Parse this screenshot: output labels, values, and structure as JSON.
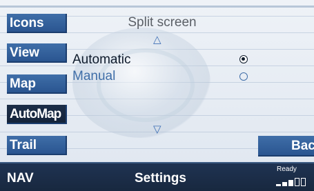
{
  "sidebar": {
    "items": [
      {
        "label": "Icons"
      },
      {
        "label": "View"
      },
      {
        "label": "Map"
      },
      {
        "label": "AutoMap"
      },
      {
        "label": "Trail"
      }
    ]
  },
  "main": {
    "title": "Split screen",
    "options": [
      {
        "label": "Automatic",
        "selected": true
      },
      {
        "label": "Manual",
        "selected": false
      }
    ]
  },
  "back_label": "Back",
  "bottom": {
    "mode": "NAV",
    "screen": "Settings",
    "status": "Ready"
  },
  "icons": {
    "up": "scroll-up-icon",
    "down": "scroll-down-icon",
    "signal": "signal-strength-icon"
  },
  "colors": {
    "button": "#2f5e9c",
    "button_active": "#1a2b44",
    "bar": "#1b2d47",
    "accent": "#3d6eb5"
  }
}
